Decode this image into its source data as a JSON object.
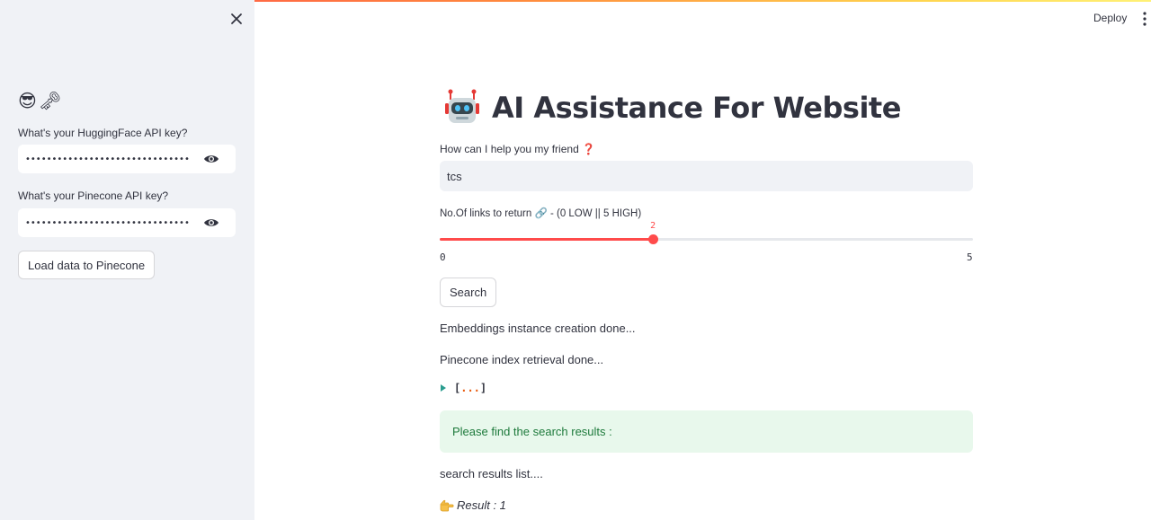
{
  "sidebar": {
    "emoji": "😎🗝",
    "huggingface_label": "What's your HuggingFace API key?",
    "huggingface_value": "••••••••••••••••••••••••••••••••••••••••••",
    "pinecone_label": "What's your Pinecone API key?",
    "pinecone_value": "••••••••••••••••••••••••••••••••••••••••••",
    "load_button": "Load data to Pinecone"
  },
  "header": {
    "deploy": "Deploy"
  },
  "main": {
    "title": "AI Assistance For Website",
    "query_label": "How can I help you my friend",
    "query_label_mark": "❓",
    "query_value": "tcs",
    "slider_label": "No.Of links to return 🔗 - (0 LOW || 5 HIGH)",
    "slider": {
      "min": 0,
      "max": 5,
      "value": 2,
      "min_label": "0",
      "max_label": "5",
      "value_label": "2"
    },
    "search_button": "Search",
    "status_1": "Embeddings instance creation done...",
    "status_2": "Pinecone index retrieval done...",
    "json_open": "[",
    "json_dots": "...",
    "json_close": "]",
    "success_message": "Please find the search results :",
    "results_list": "search results list....",
    "result_item": "Result : 1"
  },
  "colors": {
    "accent": "#ff4b4b",
    "sidebar_bg": "#f0f2f6",
    "success_bg": "#e8f8ec",
    "success_text": "#1e7a3c"
  }
}
